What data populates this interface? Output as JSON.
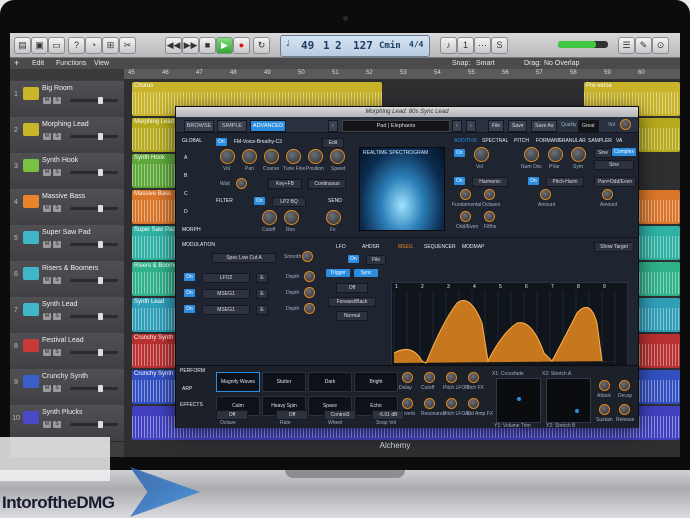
{
  "logic": {
    "lcd": {
      "bar": "49",
      "beat": "1",
      "sub": "2",
      "tempo": "127",
      "key": "Cmin",
      "sig": "4/4"
    },
    "toolbar_left": [
      "Edit",
      "Functions",
      "View"
    ],
    "snap_label": "Snap:",
    "snap_value": "Smart",
    "drag_label": "Drag:",
    "drag_value": "No Overlap",
    "ruler": [
      "45",
      "46",
      "47",
      "48",
      "49",
      "50",
      "51",
      "52",
      "53",
      "54",
      "55",
      "56",
      "57",
      "58",
      "59",
      "60"
    ],
    "tracks": [
      {
        "num": "1",
        "name": "Big Room",
        "color": "#c9b52a"
      },
      {
        "num": "2",
        "name": "Morphing Lead",
        "color": "#c9b52a"
      },
      {
        "num": "3",
        "name": "Synth Hook",
        "color": "#7ac143"
      },
      {
        "num": "4",
        "name": "Massive Bass",
        "color": "#e8842a"
      },
      {
        "num": "5",
        "name": "Super Saw Pad",
        "color": "#3fb7c9"
      },
      {
        "num": "6",
        "name": "Risers & Boomers",
        "color": "#3fb7c9"
      },
      {
        "num": "7",
        "name": "Synth Lead",
        "color": "#3fb7c9"
      },
      {
        "num": "8",
        "name": "Festival Lead",
        "color": "#c93a3a"
      },
      {
        "num": "9",
        "name": "Crunchy Synth",
        "color": "#3a5fc9"
      },
      {
        "num": "10",
        "name": "Synth Plucks",
        "color": "#4a4ac9"
      }
    ],
    "regions": [
      {
        "lane": 0,
        "name": "Chorus",
        "color": "#c8b32a"
      },
      {
        "lane": 0,
        "name": "Pre-verse",
        "color": "#c8b32a"
      },
      {
        "lane": 1,
        "name": "Morphing Lead",
        "color": "#b6ab1e"
      },
      {
        "lane": 2,
        "name": "Synth Hook",
        "color": "#5ea83a"
      },
      {
        "lane": 3,
        "name": "Massive Bass",
        "color": "#d9762a"
      },
      {
        "lane": 4,
        "name": "Super Saw Pad",
        "color": "#2fb1a3"
      },
      {
        "lane": 5,
        "name": "Risers & Boomers",
        "color": "#2fb18a"
      },
      {
        "lane": 6,
        "name": "Synth Lead",
        "color": "#2f9fb8"
      },
      {
        "lane": 7,
        "name": "Crunchy Synth",
        "color": "#b83030"
      },
      {
        "lane": 8,
        "name": "Crunchy Synth",
        "color": "#3350c0"
      },
      {
        "lane": 9,
        "name": "",
        "color": "#4040c0"
      }
    ]
  },
  "alchemy": {
    "title": "Morphing Lead: 80s Sync Lead",
    "view_tabs": [
      "BROWSE",
      "SIMPLE",
      "ADVANCED"
    ],
    "preset": "Pad | Elephants",
    "file_btn": "File",
    "save_btn": "Save",
    "saveas_btn": "Save As",
    "quality_label": "Quality",
    "quality_value": "Great",
    "vol_label": "Vol",
    "global": "GLOBAL",
    "sources": [
      "A",
      "B",
      "C",
      "D"
    ],
    "morph": "MORPH",
    "source_name": "FM-Voice-Breathy-C3",
    "edit_btn": "Edit",
    "on": "On",
    "knob_labels": [
      "Vol",
      "Pan",
      "Coarse",
      "Tune Fine",
      "Position",
      "Speed"
    ],
    "wait_label": "Wait",
    "key_value": "Key+FB",
    "continuous": "Continuous",
    "filter_label": "FILTER",
    "filter_type": "LP2 BQ",
    "cutoff": "Cutoff",
    "res": "Res",
    "send_label": "SEND",
    "fx_label": "Fx",
    "spectrogram_label": "REALTIME SPECTROGRAM",
    "synth_tabs": [
      "ADDITIVE",
      "SPECTRAL",
      "PITCH",
      "FORMANT",
      "GRANULAR",
      "SAMPLER",
      "VA"
    ],
    "additive_labels": [
      "Vol",
      "Num Osc",
      "PVar",
      "Sym"
    ],
    "harmonic": "Harmonic",
    "pitch_harm": "Pitch-Harm",
    "fundamental": "Fundamental",
    "octaves": "Octaves",
    "amount": "Amount",
    "odd_even": "Odd/Even",
    "fifths": "Fifths",
    "sine": "Sine",
    "complex": "Complex",
    "sine2": "Sine",
    "odd_even_btn": "Pan=Odd/Even",
    "modulation": "MODULATION",
    "mod_target": "Spec Low Cut A",
    "smooth": "Smooth",
    "mod_rows": [
      {
        "src": "LFO2",
        "letter": "E",
        "dest": "Depth"
      },
      {
        "src": "MSEG1",
        "letter": "E",
        "dest": "Depth"
      },
      {
        "src": "MSEG1",
        "letter": "E",
        "dest": "Depth"
      }
    ],
    "mod_tabs": [
      "LFO",
      "AHDSR",
      "MSEG",
      "SEQUENCER",
      "MODMAP"
    ],
    "show_target": "Show Target",
    "mseg_on": "On",
    "file2": "File",
    "trigger": "Trigger",
    "sync": "Sync",
    "off": "Off",
    "forward_back": "Forward/Back",
    "normal": "Normal",
    "mseg_points": [
      "1",
      "2",
      "3",
      "4",
      "5",
      "6",
      "7",
      "8",
      "9"
    ],
    "perform": "PERFORM",
    "arp": "ARP",
    "effects": "EFFECTS",
    "pads": [
      "Magnify Waves",
      "Stutter",
      "Dark",
      "Bright",
      "Calm",
      "Heavy Spin",
      "Space",
      "Echo"
    ],
    "perf_knobs_top": [
      "Delay",
      "Cutoff",
      "Pitch LFO 2",
      "Pitch FX"
    ],
    "perf_knobs_bot": [
      "Reverb",
      "Resonance",
      "Pitch LFO 2",
      "Add Amp FX"
    ],
    "xy1_label": "X1: Crossfade",
    "xy2_label": "X2: Stretch A",
    "xy1_bottom": "Y1: Volume Trim",
    "xy2_bottom": "Y2: Stretch B",
    "right_knobs": [
      "Attack",
      "Decay",
      "Sustain",
      "Release"
    ],
    "bottom_values": [
      "Off",
      "Off",
      "Control3",
      "-6.01 dB"
    ],
    "bottom_labels": [
      "Octave",
      "Rate",
      "Wheel",
      "Snap Vol"
    ],
    "brand": "Alchemy"
  },
  "watermark": "IntoroftheDMG"
}
